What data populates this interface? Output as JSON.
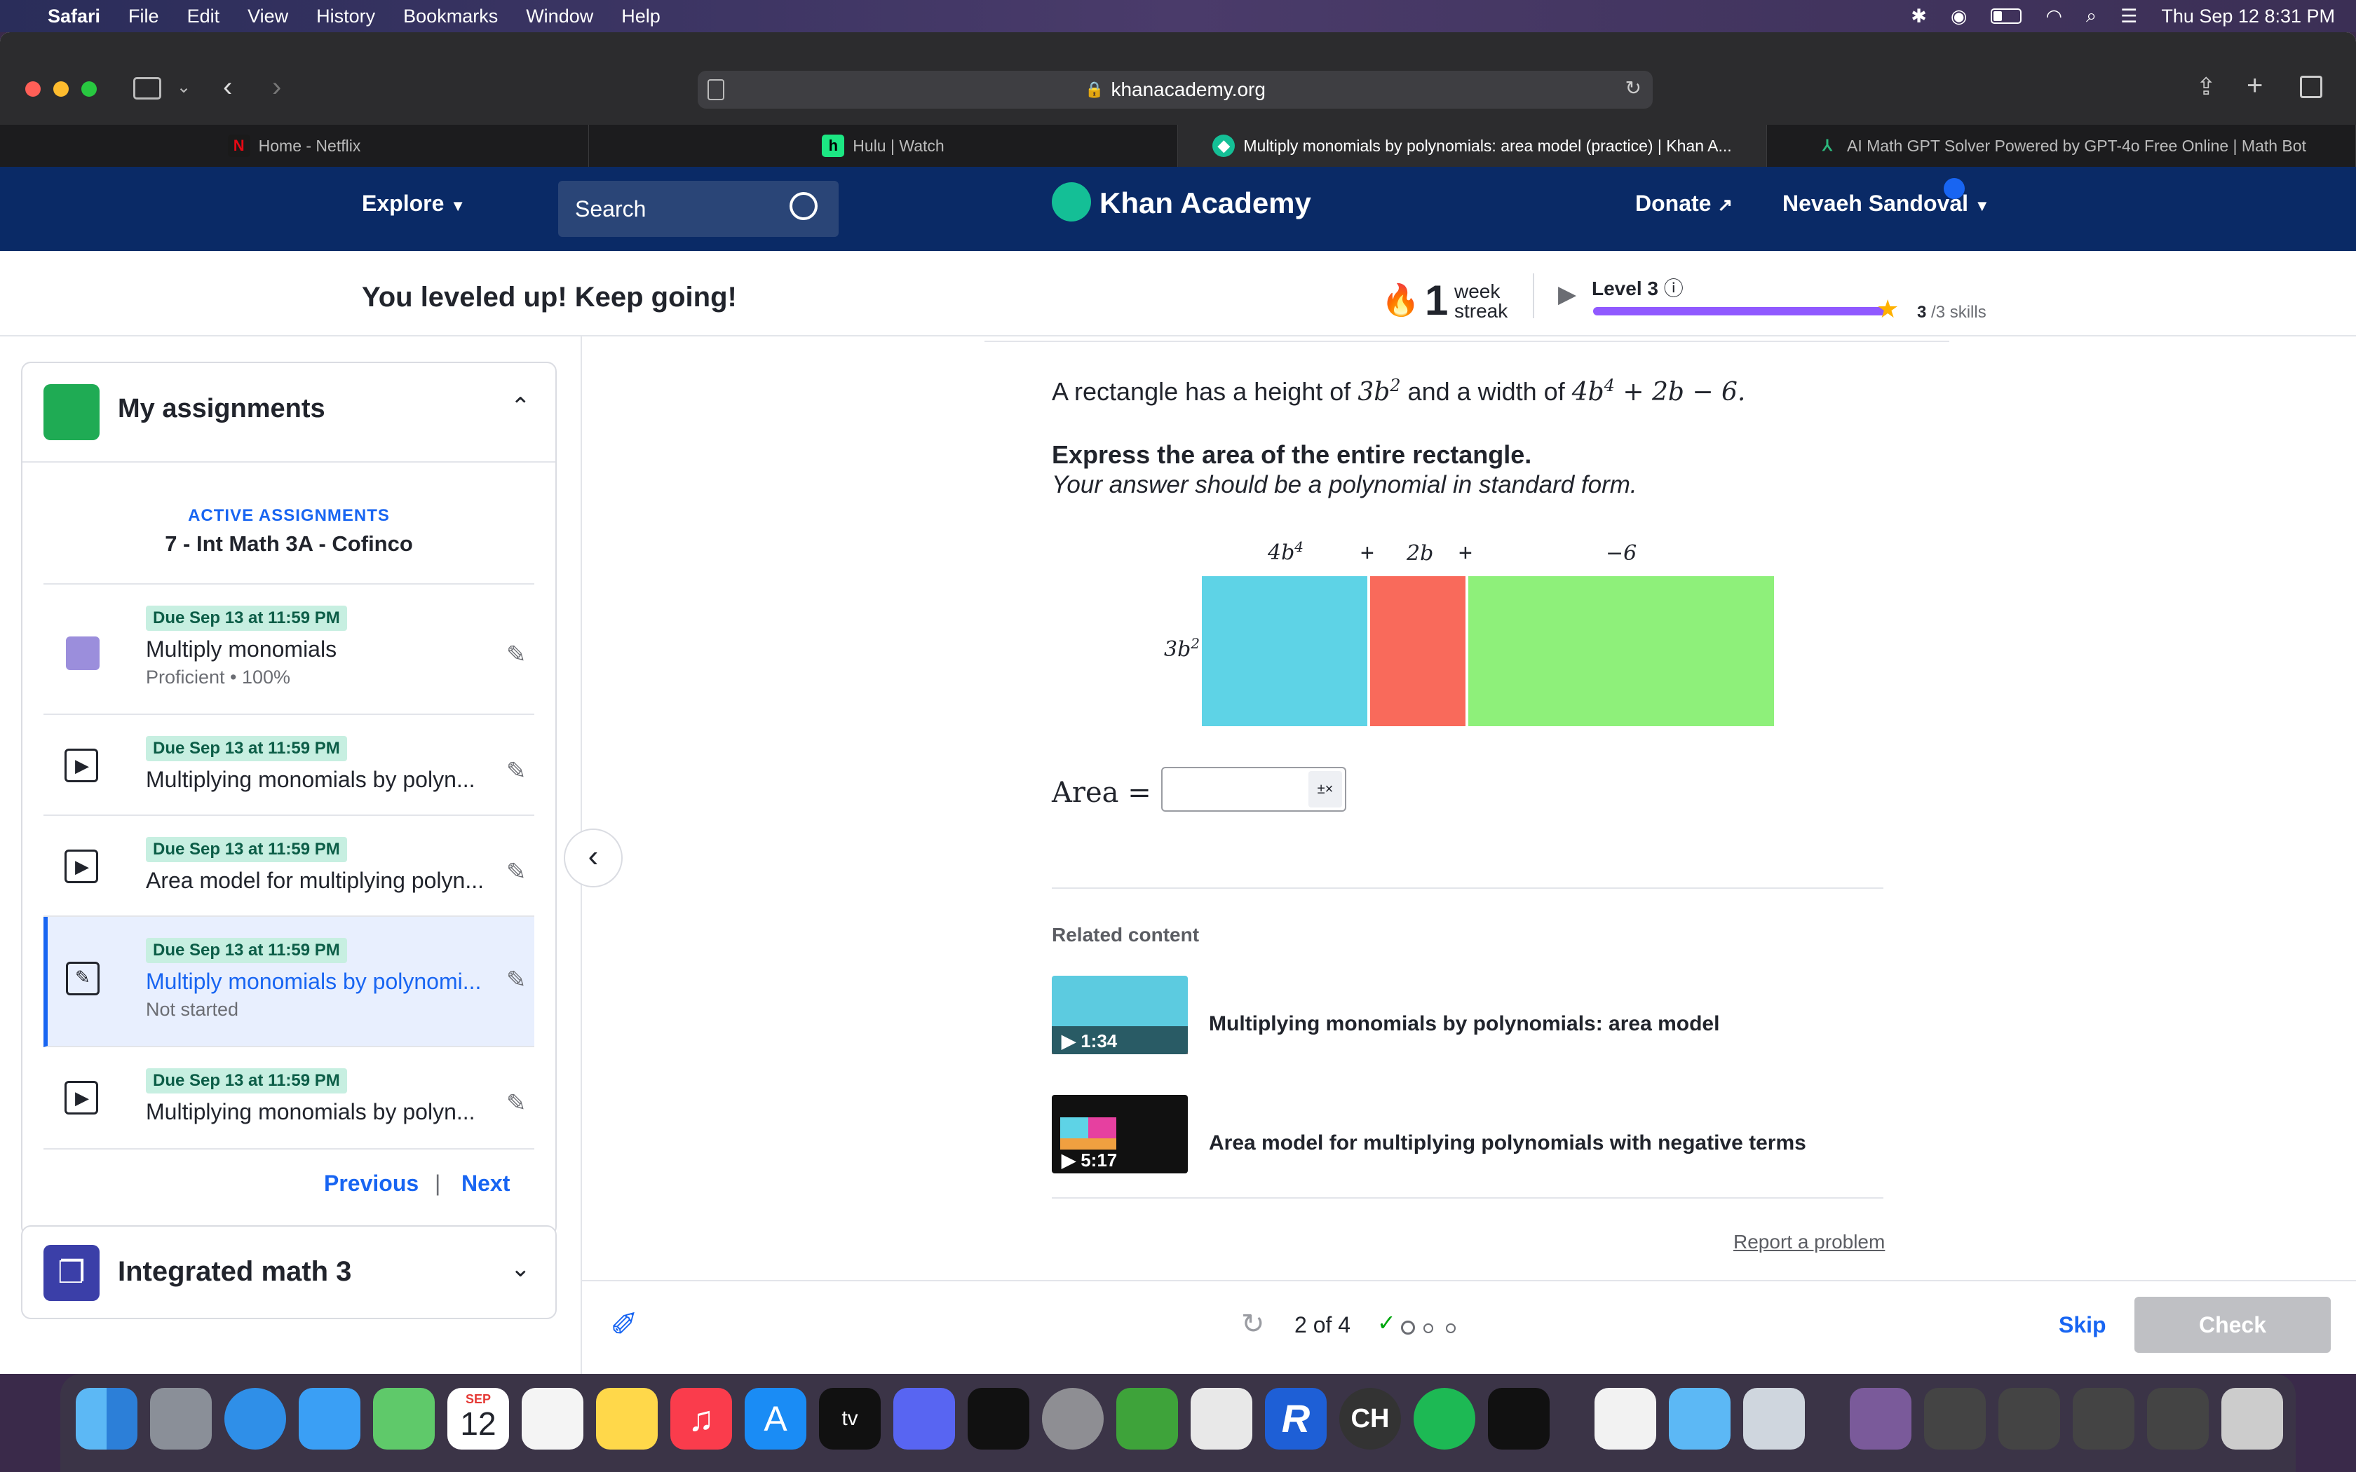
{
  "menubar": {
    "app": "Safari",
    "items": [
      "File",
      "Edit",
      "View",
      "History",
      "Bookmarks",
      "Window",
      "Help"
    ],
    "datetime": "Thu Sep 12  8:31 PM"
  },
  "browser": {
    "url": "khanacademy.org",
    "tabs": [
      {
        "label": "Home - Netflix",
        "icon": "netflix-icon"
      },
      {
        "label": "Hulu | Watch",
        "icon": "hulu-icon"
      },
      {
        "label": "Multiply monomials by polynomials: area model (practice) | Khan A...",
        "icon": "khan-academy-icon",
        "active": true
      },
      {
        "label": "AI Math GPT Solver Powered by GPT-4o Free Online | Math Bot",
        "icon": "mathgpt-icon"
      }
    ]
  },
  "kanav": {
    "explore": "Explore",
    "search_placeholder": "Search",
    "logo": "Khan Academy",
    "donate": "Donate",
    "user": "Nevaeh Sandoval"
  },
  "levelbar": {
    "message": "You leveled up! Keep going!",
    "streak_num": "1",
    "streak_w1": "week",
    "streak_w2": "streak",
    "level": "Level 3",
    "skills_done": "3",
    "skills_total": "/3 skills",
    "progress": 1.0
  },
  "sidebar": {
    "title": "My assignments",
    "active_label": "ACTIVE ASSIGNMENTS",
    "class_name": "7 - Int Math 3A - Cofinco",
    "assignments": [
      {
        "due": "Due Sep 13 at 11:59 PM",
        "name": "Multiply monomials",
        "sub": "Proficient • 100%",
        "type": "mastery"
      },
      {
        "due": "Due Sep 13 at 11:59 PM",
        "name": "Multiplying monomials by polyn...",
        "sub": "",
        "type": "video"
      },
      {
        "due": "Due Sep 13 at 11:59 PM",
        "name": "Area model for multiplying polyn...",
        "sub": "",
        "type": "video"
      },
      {
        "due": "Due Sep 13 at 11:59 PM",
        "name": "Multiply monomials by polynomi...",
        "sub": "Not started",
        "type": "exercise",
        "selected": true
      },
      {
        "due": "Due Sep 13 at 11:59 PM",
        "name": "Multiplying monomials by polyn...",
        "sub": "",
        "type": "video"
      }
    ],
    "previous": "Previous",
    "sep": "|",
    "next": "Next",
    "course": "Integrated math 3"
  },
  "problem": {
    "stmt_a": "A rectangle has a height of ",
    "h_base": "3b",
    "h_exp": "2",
    "stmt_b": " and a width of ",
    "w_base": "4b",
    "w_exp": "4",
    "w_rest": " + 2b − 6.",
    "bold": "Express the area of the entire rectangle.",
    "italic": "Your answer should be a polynomial in standard form.",
    "area_label": "Area =",
    "model": {
      "top": [
        "4b",
        "+",
        "2b",
        "+",
        "−6"
      ],
      "top_exp": "4",
      "side_base": "3b",
      "side_exp": "2",
      "colors": {
        "a": "#5ed3e6",
        "b": "#f96a5b",
        "c": "#8ef07a"
      }
    },
    "related_title": "Related content",
    "related": [
      {
        "title": "Multiplying monomials by polynomials: area model",
        "duration": "1:34"
      },
      {
        "title": "Area model for multiplying polynomials with negative terms",
        "duration": "5:17"
      }
    ],
    "report": "Report a problem"
  },
  "footer": {
    "progress": "2 of 4",
    "skip": "Skip",
    "check": "Check"
  },
  "dock": {
    "calendar_month": "SEP",
    "calendar_day": "12",
    "tv": "tv",
    "ch": "CH"
  }
}
